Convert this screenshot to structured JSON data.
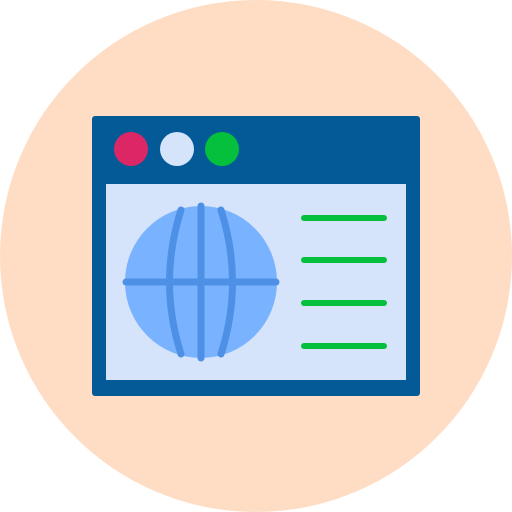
{
  "icon": {
    "name": "browser-globe-icon",
    "colors": {
      "background_circle": "#FFDCC4",
      "window_frame": "#045A96",
      "window_content": "#D5E3FB",
      "dot_red": "#DC2767",
      "dot_light": "#D5E3FB",
      "dot_green": "#05C03C",
      "globe_fill": "#79B3FF",
      "globe_lines": "#4D90E6",
      "text_lines": "#05C03C"
    },
    "window_controls": [
      "close-dot",
      "minimize-dot",
      "maximize-dot"
    ],
    "content_line_count": 4
  }
}
